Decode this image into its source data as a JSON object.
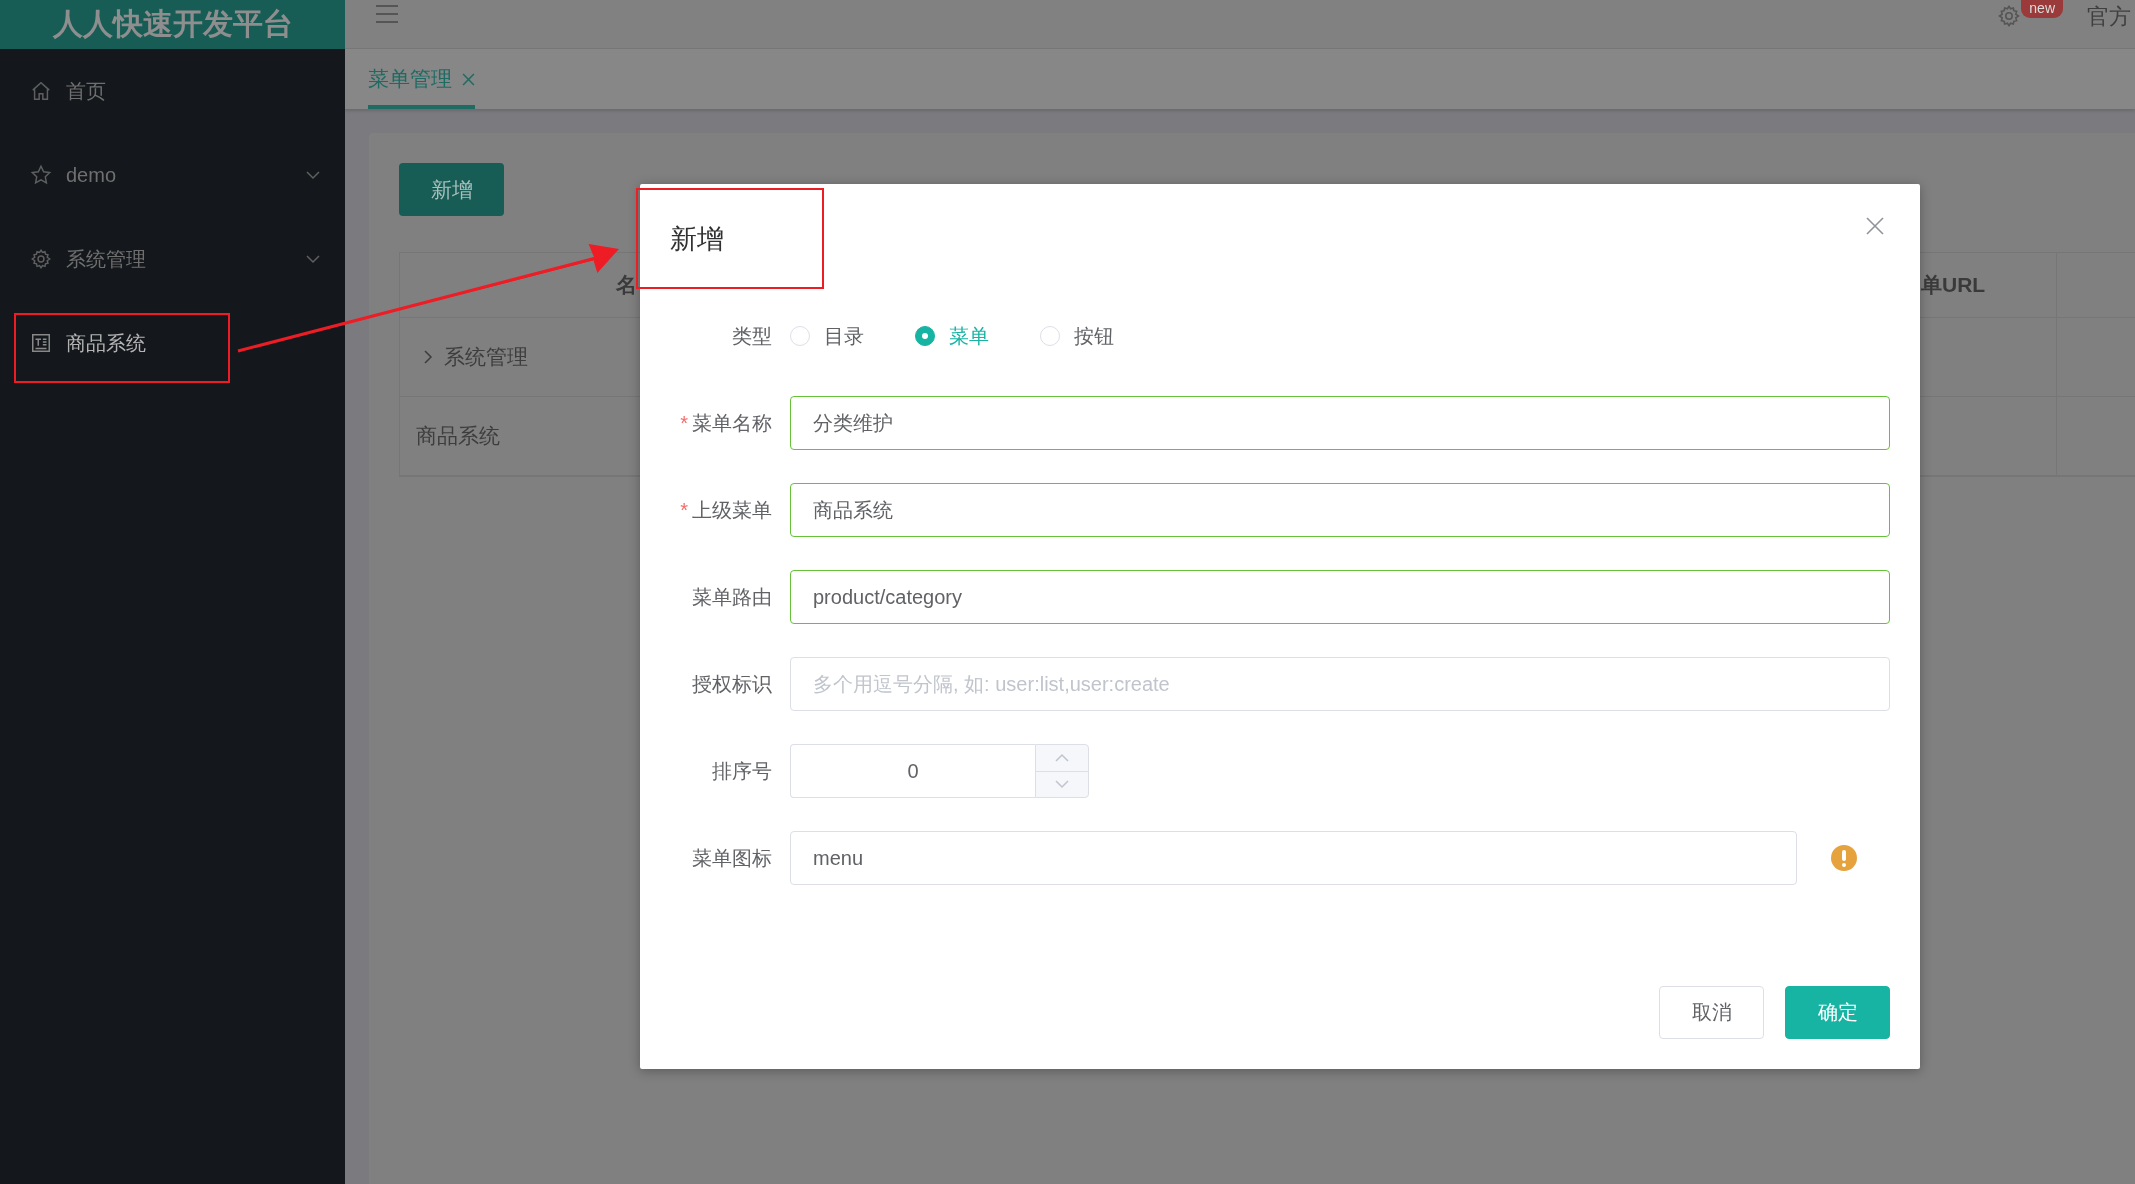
{
  "sidebar": {
    "logo": "人人快速开发平台",
    "items": [
      {
        "label": "首页",
        "selected": false,
        "marked": false
      },
      {
        "label": "demo",
        "selected": false,
        "expanded": false,
        "marked": false
      },
      {
        "label": "系统管理",
        "selected": false,
        "expanded": false,
        "marked": false
      },
      {
        "label": "商品系统",
        "selected": true,
        "marked": true
      }
    ]
  },
  "topbar": {
    "badge": "new",
    "link": "官方"
  },
  "tabs": [
    {
      "label": "菜单管理",
      "selected": true,
      "closable": true
    }
  ],
  "content": {
    "add_button": "新增",
    "table": {
      "columns": [
        {
          "label": "名"
        },
        {
          "label": "单URL"
        }
      ],
      "rows": [
        {
          "name": "系统管理",
          "expanded": false
        },
        {
          "name": "商品系统"
        }
      ]
    }
  },
  "dialog": {
    "title": "新增",
    "marked": true,
    "required_mark": "*",
    "fields": [
      {
        "kind": "radio",
        "label": "类型",
        "required": false,
        "options": [
          {
            "label": "目录",
            "selected": false
          },
          {
            "label": "菜单",
            "selected": true
          },
          {
            "label": "按钮",
            "selected": false
          }
        ]
      },
      {
        "kind": "text",
        "label": "菜单名称",
        "required": true,
        "value": "分类维护",
        "valid": true
      },
      {
        "kind": "text",
        "label": "上级菜单",
        "required": true,
        "value": "商品系统",
        "valid": true
      },
      {
        "kind": "text",
        "label": "菜单路由",
        "required": false,
        "value": "product/category",
        "valid": true
      },
      {
        "kind": "text",
        "label": "授权标识",
        "required": false,
        "placeholder": "多个用逗号分隔, 如: user:list,user:create",
        "valid": false
      },
      {
        "kind": "number",
        "label": "排序号",
        "required": false,
        "value": "0"
      },
      {
        "kind": "icon",
        "label": "菜单图标",
        "required": false,
        "value": "menu",
        "valid": false,
        "warning": true
      }
    ],
    "buttons": [
      {
        "label": "取消",
        "kind": "cancel"
      },
      {
        "label": "确定",
        "kind": "primary"
      }
    ]
  }
}
